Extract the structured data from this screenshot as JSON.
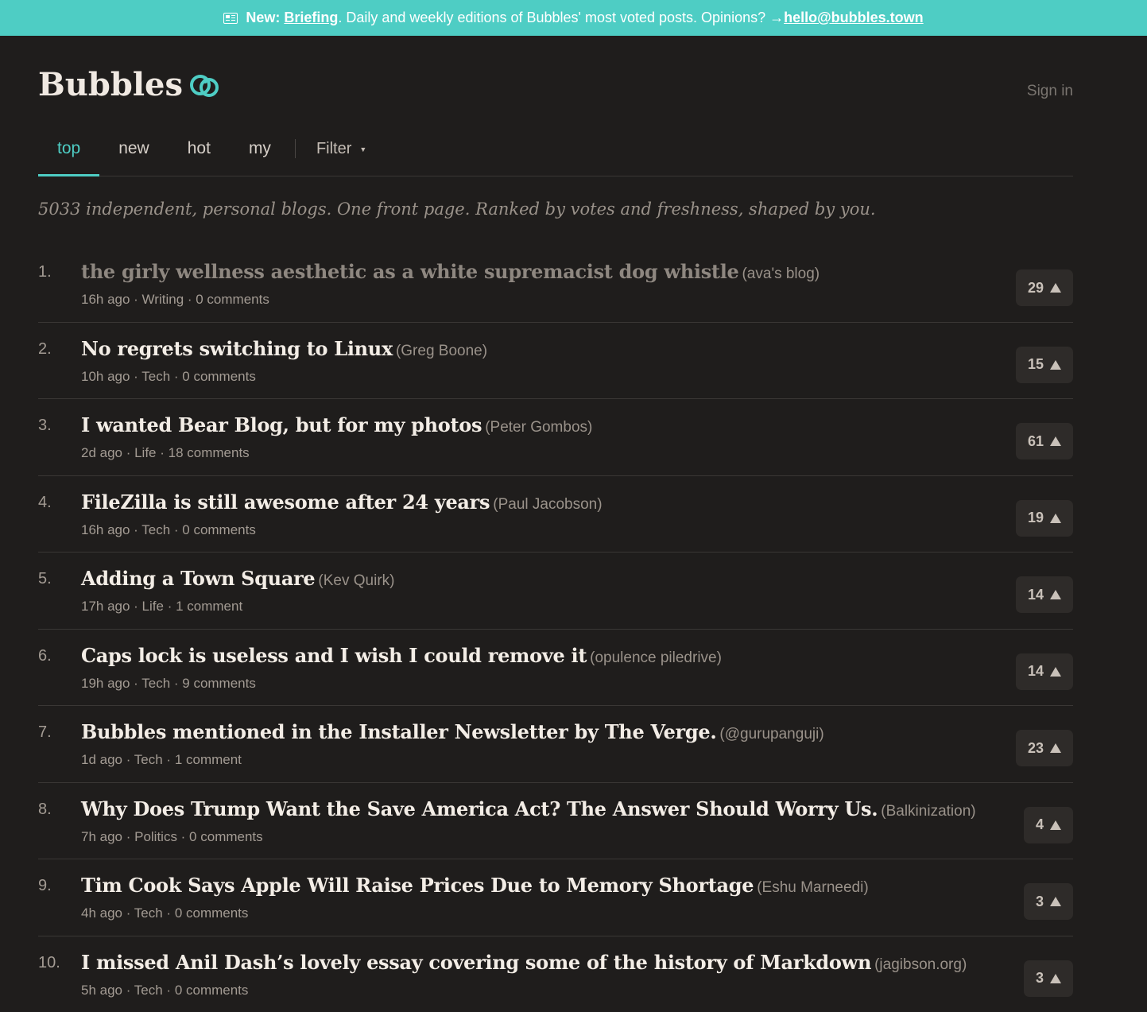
{
  "banner": {
    "new_label": "New:",
    "briefing_link": "Briefing",
    "text": ". Daily and weekly editions of Bubbles' most voted posts. Opinions? → ",
    "email_link": "hello@bubbles.town"
  },
  "header": {
    "logo": "Bubbles",
    "sign_in": "Sign in"
  },
  "nav": {
    "tabs": [
      "top",
      "new",
      "hot",
      "my"
    ],
    "active": "top",
    "filter": "Filter"
  },
  "tagline": "5033 independent, personal blogs. One front page. Ranked by votes and freshness, shaped by you.",
  "posts": [
    {
      "rank": "1.",
      "title": "the girly wellness aesthetic as a white supremacist dog whistle",
      "source": "(ava's blog)",
      "meta": "16h ago · Writing · 0 comments",
      "votes": "29",
      "visited": true
    },
    {
      "rank": "2.",
      "title": "No regrets switching to Linux",
      "source": "(Greg Boone)",
      "meta": "10h ago · Tech · 0 comments",
      "votes": "15",
      "visited": false
    },
    {
      "rank": "3.",
      "title": "I wanted Bear Blog, but for my photos",
      "source": "(Peter Gombos)",
      "meta": "2d ago · Life · 18 comments",
      "votes": "61",
      "visited": false
    },
    {
      "rank": "4.",
      "title": "FileZilla is still awesome after 24 years",
      "source": "(Paul Jacobson)",
      "meta": "16h ago · Tech · 0 comments",
      "votes": "19",
      "visited": false
    },
    {
      "rank": "5.",
      "title": "Adding a Town Square",
      "source": "(Kev Quirk)",
      "meta": "17h ago · Life · 1 comment",
      "votes": "14",
      "visited": false
    },
    {
      "rank": "6.",
      "title": "Caps lock is useless and I wish I could remove it",
      "source": "(opulence piledrive)",
      "meta": "19h ago · Tech · 9 comments",
      "votes": "14",
      "visited": false
    },
    {
      "rank": "7.",
      "title": "Bubbles mentioned in the Installer Newsletter by The Verge.",
      "source": "(@gurupanguji)",
      "meta": "1d ago · Tech · 1 comment",
      "votes": "23",
      "visited": false
    },
    {
      "rank": "8.",
      "title": "Why Does Trump Want the Save America Act? The Answer Should Worry Us.",
      "source": "(Balkinization)",
      "meta": "7h ago · Politics · 0 comments",
      "votes": "4",
      "visited": false
    },
    {
      "rank": "9.",
      "title": "Tim Cook Says Apple Will Raise Prices Due to Memory Shortage",
      "source": "(Eshu Marneedi)",
      "meta": "4h ago · Tech · 0 comments",
      "votes": "3",
      "visited": false
    },
    {
      "rank": "10.",
      "title": "I missed Anil Dash’s lovely essay covering some of the history of Markdown",
      "source": "(jagibson.org)",
      "meta": "5h ago · Tech · 0 comments",
      "votes": "3",
      "visited": false
    }
  ],
  "colors": {
    "accent": "#4ecdc4",
    "background": "#1f1d1c"
  },
  "icons": {
    "banner": "newspaper-icon",
    "logo": "bubbles-icon",
    "vote": "upvote-arrow-icon",
    "filter": "caret-down-icon"
  }
}
